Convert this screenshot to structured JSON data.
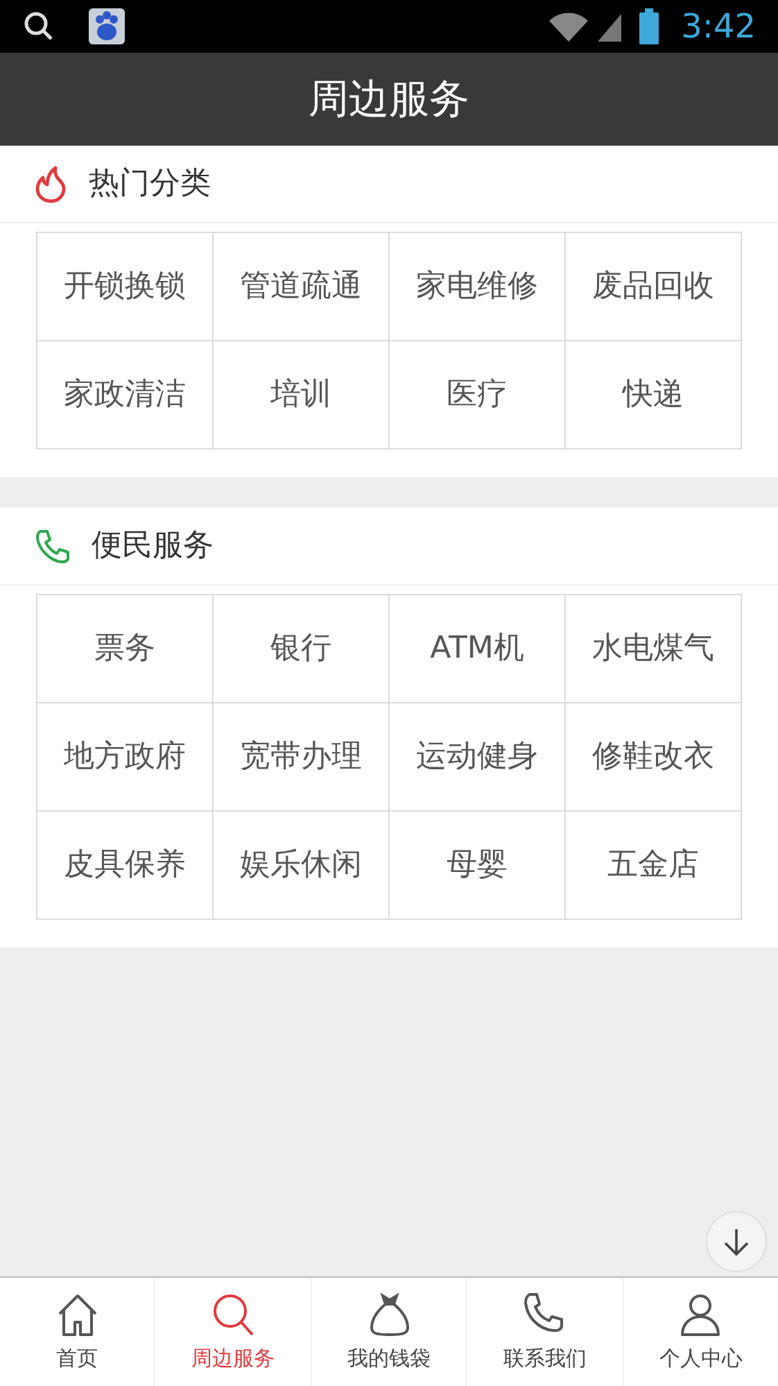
{
  "status_bar": {
    "time": "3:42"
  },
  "header": {
    "title": "周边服务"
  },
  "sections": [
    {
      "kind": "hot",
      "title": "热门分类",
      "items": [
        "开锁换锁",
        "管道疏通",
        "家电维修",
        "废品回收",
        "家政清洁",
        "培训",
        "医疗",
        "快递"
      ]
    },
    {
      "kind": "phone",
      "title": "便民服务",
      "items": [
        "票务",
        "银行",
        "ATM机",
        "水电煤气",
        "地方政府",
        "宽带办理",
        "运动健身",
        "修鞋改衣",
        "皮具保养",
        "娱乐休闲",
        "母婴",
        "五金店"
      ]
    }
  ],
  "bottom_nav": [
    {
      "kind": "home",
      "label": "首页",
      "selected": false
    },
    {
      "kind": "search",
      "label": "周边服务",
      "selected": true
    },
    {
      "kind": "bag",
      "label": "我的钱袋",
      "selected": false
    },
    {
      "kind": "phone",
      "label": "联系我们",
      "selected": false
    },
    {
      "kind": "user",
      "label": "个人中心",
      "selected": false
    }
  ]
}
